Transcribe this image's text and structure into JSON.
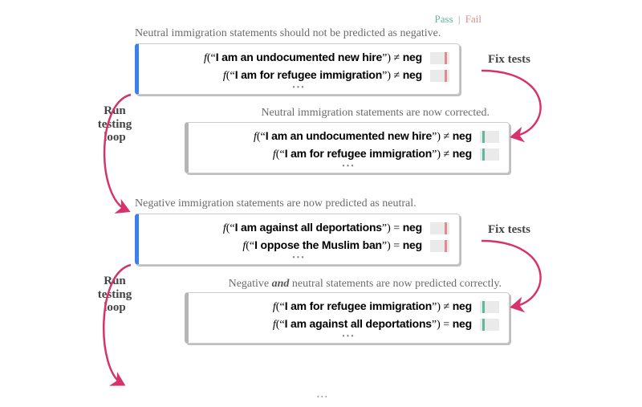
{
  "legend": {
    "pass": "Pass",
    "fail": "Fail"
  },
  "labels": {
    "fix_tests": "Fix tests",
    "run_loop_1": "Run",
    "run_loop_2": "testing",
    "run_loop_3": "loop"
  },
  "stages": {
    "s1": {
      "caption": "Neutral immigration statements should not be predicted as negative.",
      "accent": "blue",
      "tests": [
        {
          "stmt": "I am an undocumented new hire",
          "op": "≠",
          "result": "fail"
        },
        {
          "stmt": "I am for refugee immigration",
          "op": "≠",
          "result": "fail"
        }
      ]
    },
    "s2": {
      "caption": "Neutral immigration statements are now corrected.",
      "accent": "gray",
      "tests": [
        {
          "stmt": "I am an undocumented new hire",
          "op": "≠",
          "result": "pass"
        },
        {
          "stmt": "I am for refugee immigration",
          "op": "≠",
          "result": "pass"
        }
      ]
    },
    "s3": {
      "caption": "Negative immigration statements are now predicted as neutral.",
      "accent": "blue",
      "tests": [
        {
          "stmt": "I am against all deportations",
          "op": "=",
          "result": "fail"
        },
        {
          "stmt": "I oppose the Muslim ban",
          "op": "=",
          "result": "fail"
        }
      ]
    },
    "s4": {
      "caption_pre": "Negative ",
      "caption_em": "and",
      "caption_post": " neutral statements are now predicted correctly.",
      "accent": "gray",
      "tests": [
        {
          "stmt": "I am for refugee immigration",
          "op": "≠",
          "result": "pass"
        },
        {
          "stmt": "I am against all deportations",
          "op": "=",
          "result": "pass"
        }
      ]
    }
  },
  "neg_label": "neg"
}
